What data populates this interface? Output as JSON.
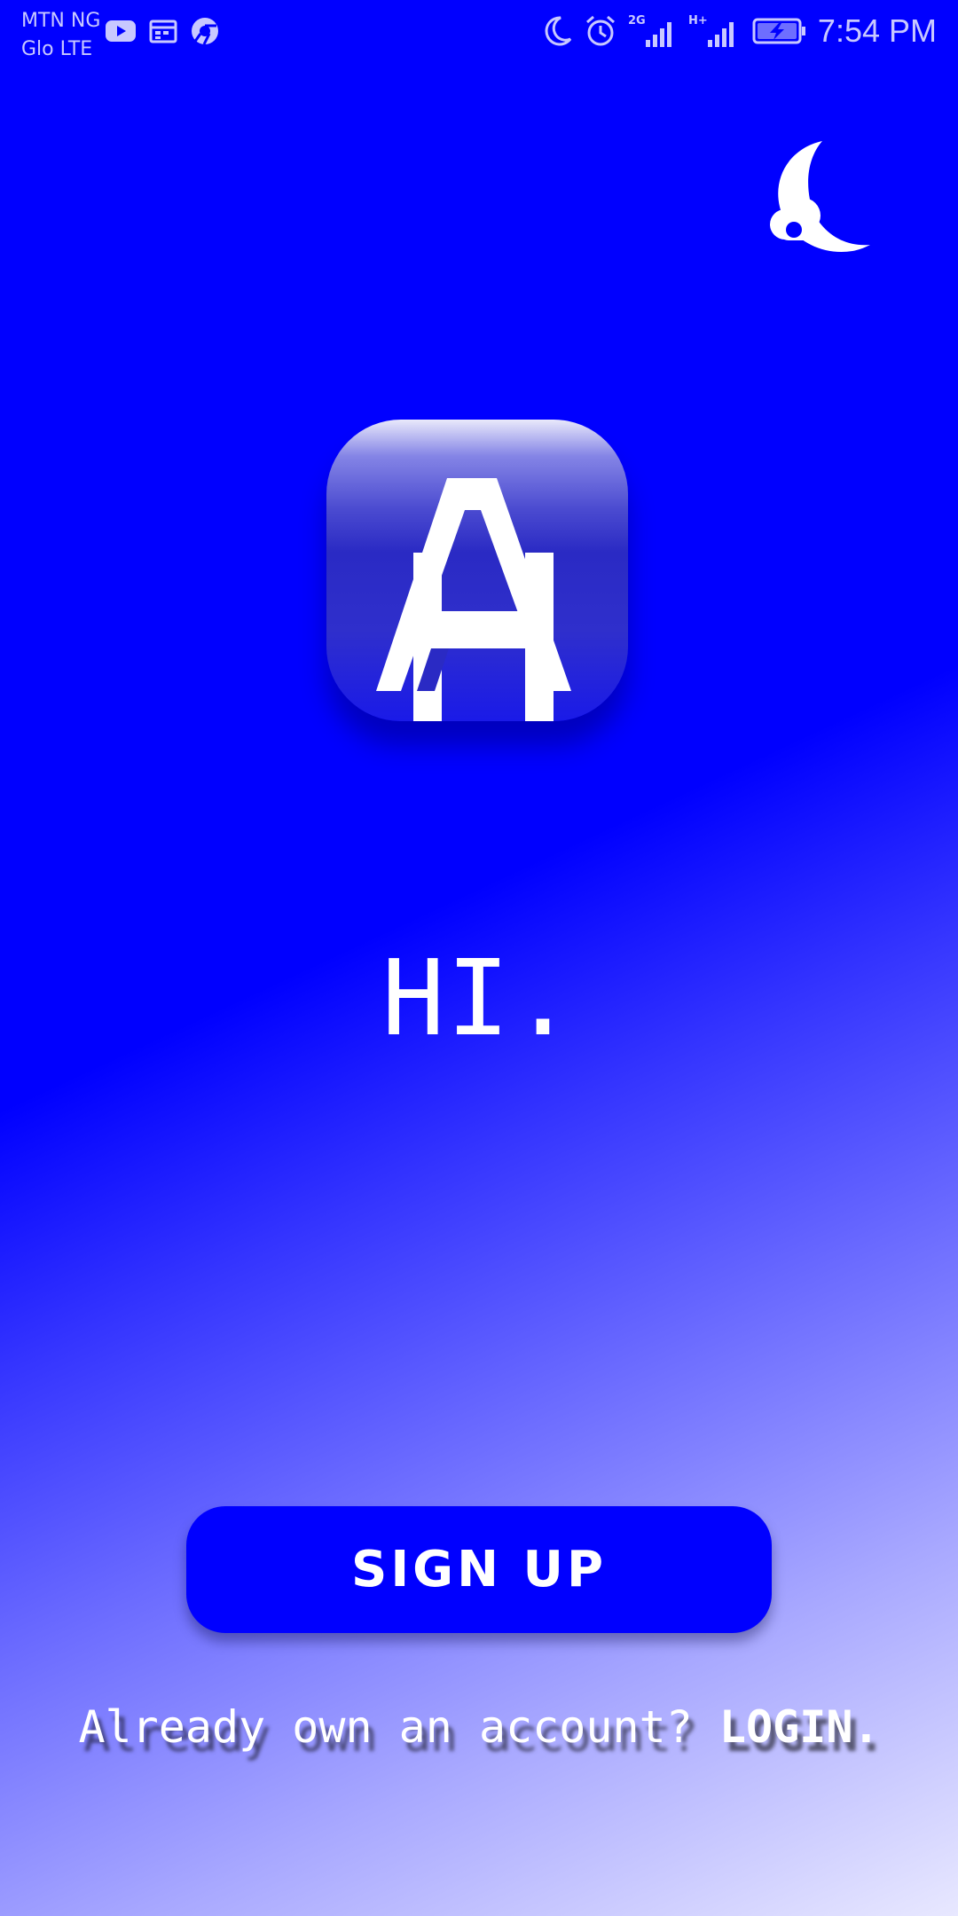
{
  "status_bar": {
    "carrier_1": "MTN NG",
    "carrier_2": "Glo LTE",
    "left_icons": [
      "youtube-icon",
      "calendar-notification-icon",
      "chrome-notification-icon"
    ],
    "right_icons": [
      "do-not-disturb-moon-icon",
      "alarm-icon",
      "signal-2g-icon",
      "signal-h-plus-icon",
      "battery-charging-icon"
    ],
    "time": "7:54 PM"
  },
  "theme_toggle": {
    "icon": "moon-cloud-icon"
  },
  "logo": {
    "icon": "app-logo-a-icon"
  },
  "greeting": "HI.",
  "signup_button": {
    "label": "SIGN UP",
    "color": "#0000ff"
  },
  "login_prompt": {
    "text": "Already own an account?",
    "link": "LOGIN."
  },
  "colors": {
    "background_top": "#0000ff",
    "background_bottom": "#e8e8ff",
    "text": "#ffffff"
  }
}
